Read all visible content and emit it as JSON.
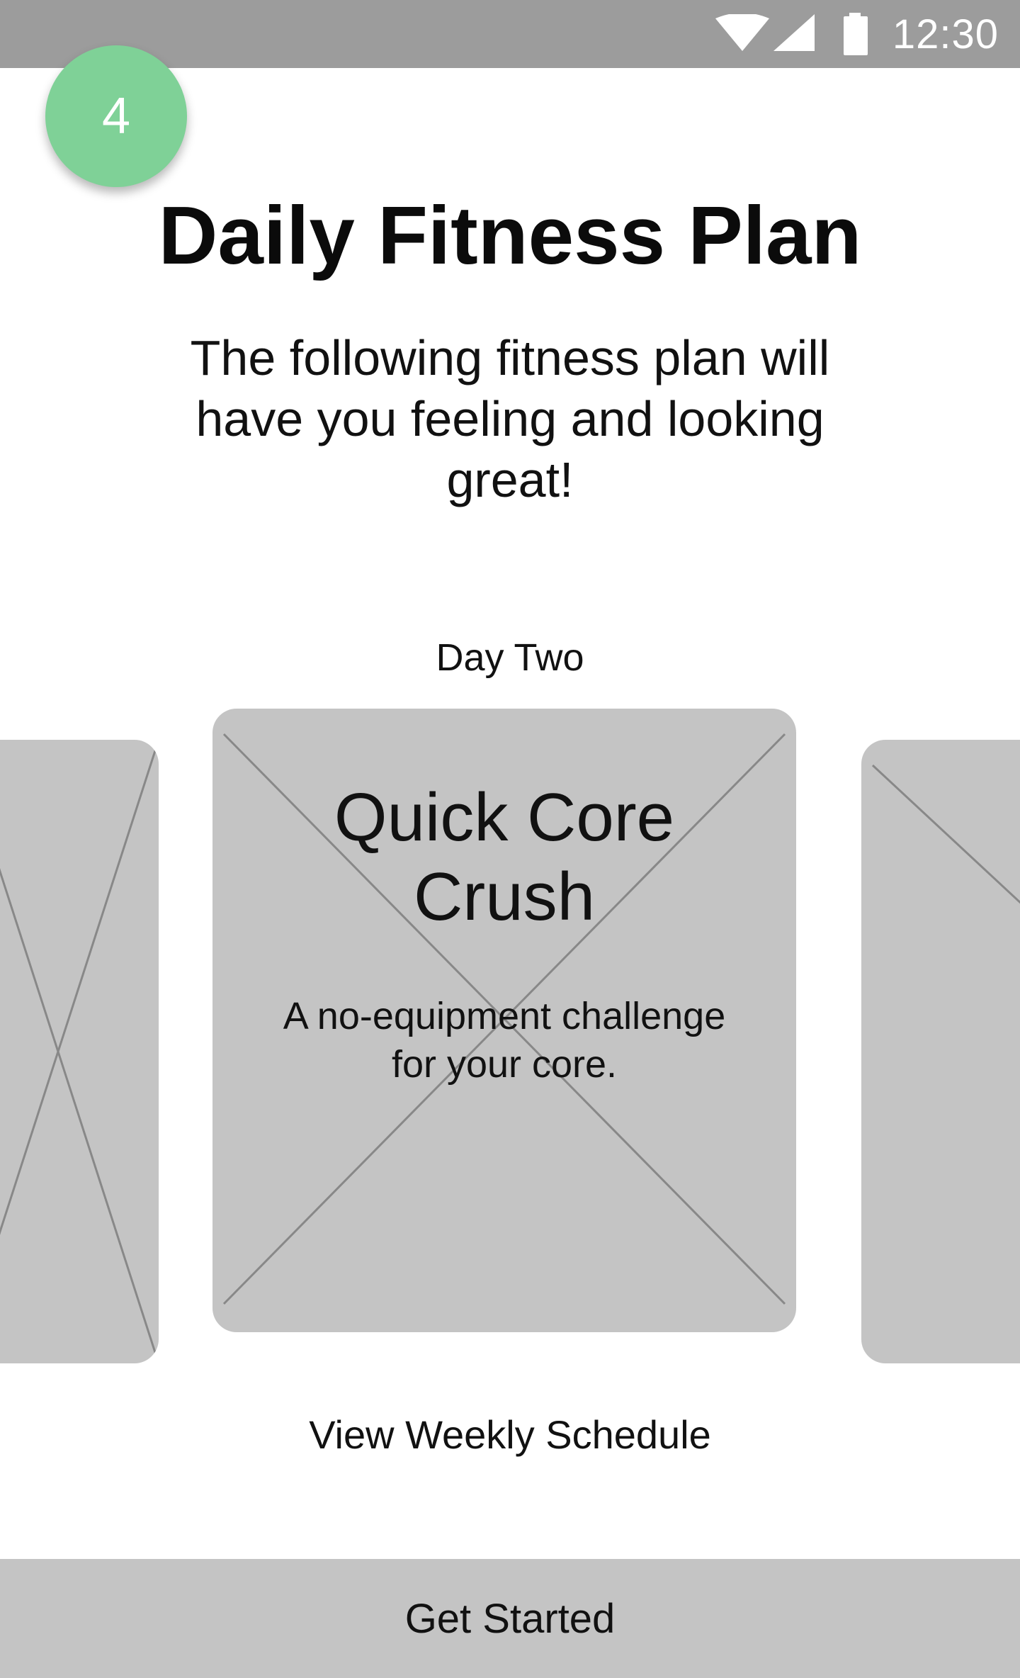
{
  "status_bar": {
    "time": "12:30",
    "icons": [
      "wifi-icon",
      "cell-signal-icon",
      "battery-icon"
    ],
    "background": "#9c9c9c"
  },
  "step_badge": {
    "value": "4",
    "color": "#7fd197"
  },
  "header": {
    "title": "Daily Fitness Plan",
    "intro": "The following fitness plan will have you feeling and looking great!"
  },
  "carousel": {
    "day_label": "Day Two",
    "active_card": {
      "title": "Quick Core Crush",
      "description": "A no-equipment challenge for your core."
    }
  },
  "links": {
    "weekly_schedule": "View Weekly Schedule"
  },
  "footer": {
    "primary_button": "Get Started"
  }
}
